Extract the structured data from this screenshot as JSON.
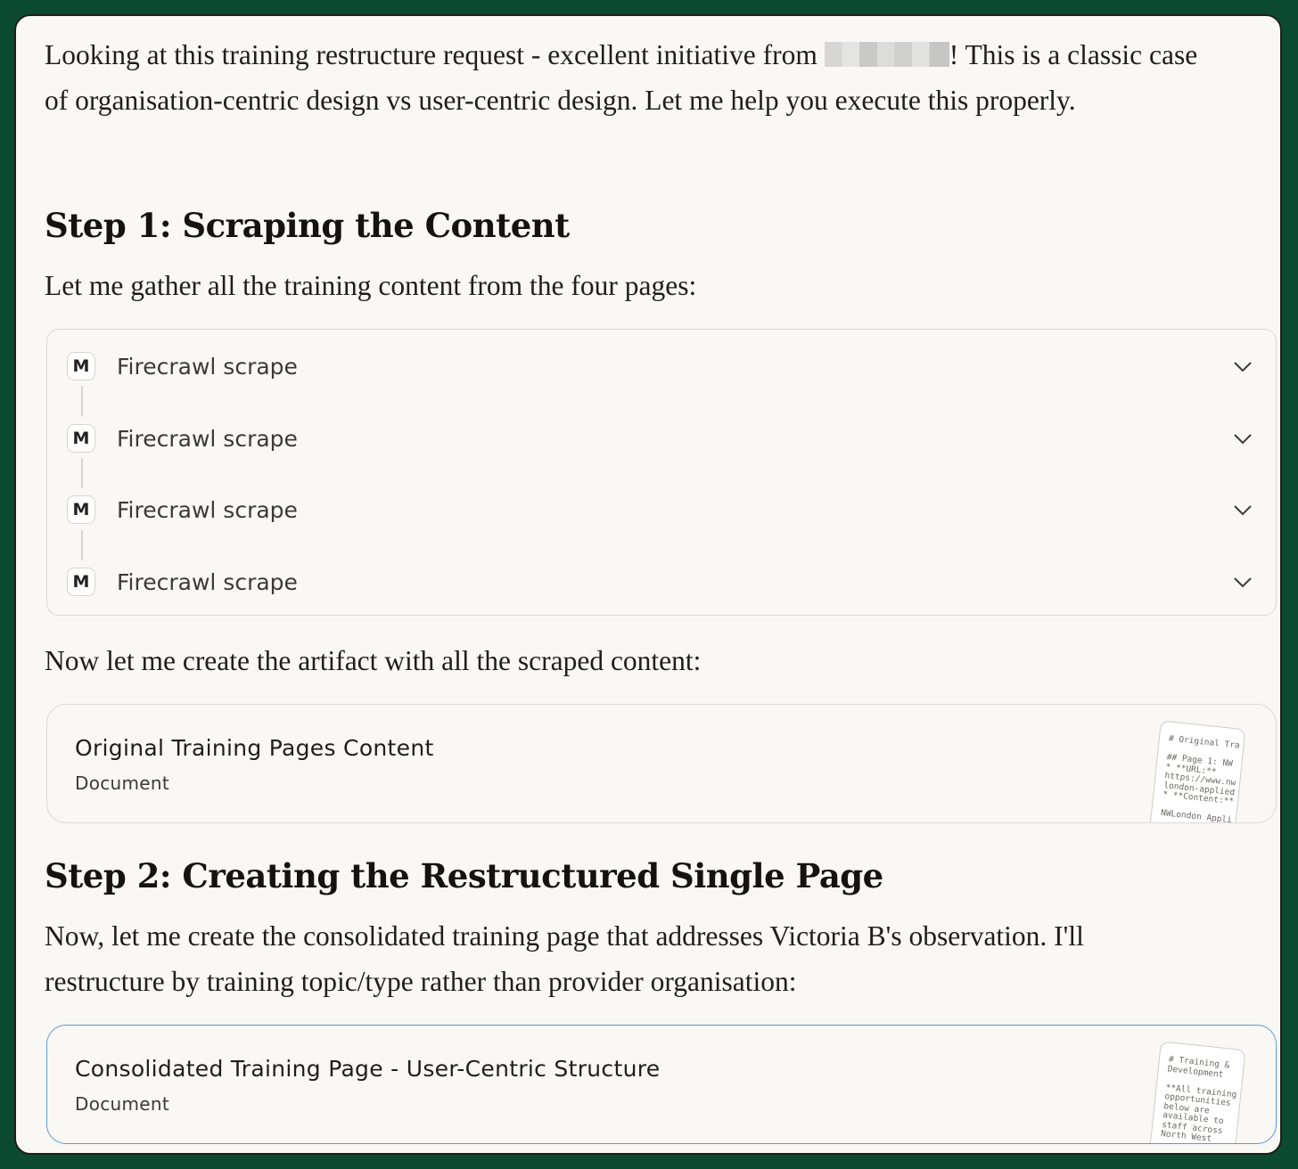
{
  "intro": {
    "text_before": "Looking at this training restructure request - excellent initiative from ",
    "text_after": "! This is a classic case of organisation-centric design vs user-centric design. Let me help you execute this properly."
  },
  "step1": {
    "heading": "Step 1: Scraping the Content",
    "lead": "Let me gather all the training content from the four pages:"
  },
  "tool_calls": [
    {
      "badge": "M",
      "label": "Firecrawl scrape"
    },
    {
      "badge": "M",
      "label": "Firecrawl scrape"
    },
    {
      "badge": "M",
      "label": "Firecrawl scrape"
    },
    {
      "badge": "M",
      "label": "Firecrawl scrape"
    }
  ],
  "after_tools": "Now let me create the artifact with all the scraped content:",
  "artifact1": {
    "title": "Original Training Pages Content",
    "type": "Document",
    "preview": "# Original Tra\n\n## Page 1: NW\n* **URL:**\nhttps://www.nw\nlondon-applied\n* **Content:**\n\nNWLondon Appli"
  },
  "step2": {
    "heading": "Step 2: Creating the Restructured Single Page",
    "lead": "Now, let me create the consolidated training page that addresses Victoria B's observation. I'll restructure by training topic/type rather than provider organisation:"
  },
  "artifact2": {
    "title": "Consolidated Training Page - User-Centric Structure",
    "type": "Document",
    "preview": "# Training &\nDevelopment\n\n**All training\nopportunities\nbelow are\navailable to\nstaff across\nNorth West"
  },
  "colors": {
    "outer_border": "#0b4a30",
    "surface": "#f9f8f4",
    "active_border": "#5b9bd5"
  }
}
